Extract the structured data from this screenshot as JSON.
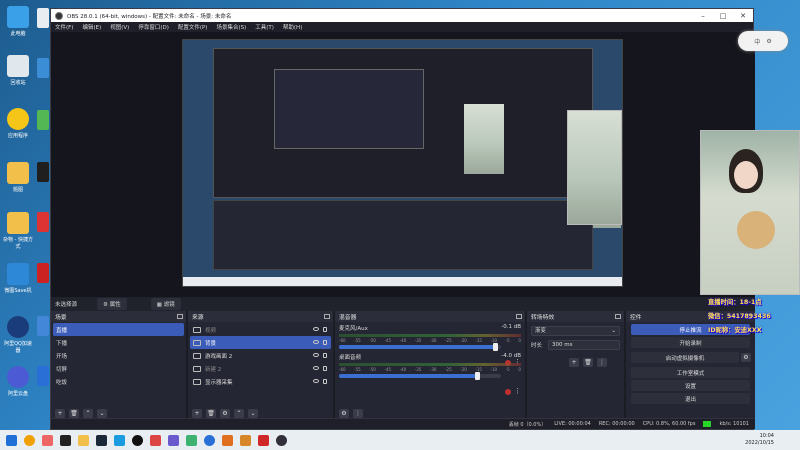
{
  "window": {
    "title": "OBS 28.0.1 (64-bit, windows) - 配置文件: 未命名 - 场景: 未命名"
  },
  "menu": [
    "文件(F)",
    "编辑(E)",
    "视图(V)",
    "停靠窗口(D)",
    "配置文件(P)",
    "场景集合(S)",
    "工具(T)",
    "帮助(H)"
  ],
  "toolbar_row": {
    "no_source": "未选择源",
    "properties": "属性",
    "filters": "滤镜"
  },
  "scenes": {
    "title": "场景",
    "items": [
      "直播",
      "下播",
      "开场",
      "切屏",
      "吃饭"
    ],
    "selected_index": 0
  },
  "sources": {
    "title": "来源",
    "items": [
      {
        "label": "视频",
        "dim": true
      },
      {
        "label": "背景",
        "dim": false,
        "selected": true
      },
      {
        "label": "游戏画面 2",
        "dim": false
      },
      {
        "label": "新建 2",
        "dim": true
      },
      {
        "label": "显示器采集",
        "dim": false
      }
    ]
  },
  "mixer": {
    "title": "混音器",
    "ticks": [
      "-60",
      "-55",
      "-50",
      "-45",
      "-40",
      "-35",
      "-30",
      "-25",
      "-20",
      "-15",
      "-10",
      "-5",
      "0"
    ],
    "channels": [
      {
        "name": "麦克风/Aux",
        "db": "-0.1 dB",
        "level": 0.97
      },
      {
        "name": "桌面音频",
        "db": "-4.0 dB",
        "level": 0.86
      }
    ]
  },
  "transitions": {
    "title": "转场特效",
    "type": "渐变",
    "duration_label": "时长",
    "duration": "300 ms"
  },
  "controls": {
    "title": "控件",
    "buttons": [
      "停止推流",
      "开始录制",
      "启动虚拟摄像机",
      "工作室模式",
      "设置",
      "退出"
    ]
  },
  "statusbar": {
    "dropped": "丢帧 0（0.0%）",
    "live": "LIVE: 00:00:04",
    "rec": "REC: 00:00:00",
    "cpu": "CPU: 0.8%, 60.00 fps",
    "kbps": "kb/s: 10101"
  },
  "overlay_text": {
    "line1": "直播时间：18-1点",
    "line2": "微信：5417893436",
    "line3": "ID昵称：安迪XXX"
  },
  "zoom_widget": {
    "label": "中"
  },
  "desktop": {
    "icons": [
      "此电脑",
      "回收站",
      "应用程序",
      "题图",
      "杂物 - 快捷方式",
      "微图Save机",
      "阿里QQ加速器",
      "阿里云盘"
    ]
  },
  "taskbar": {
    "time": "10:04",
    "date": "2022/10/15"
  }
}
